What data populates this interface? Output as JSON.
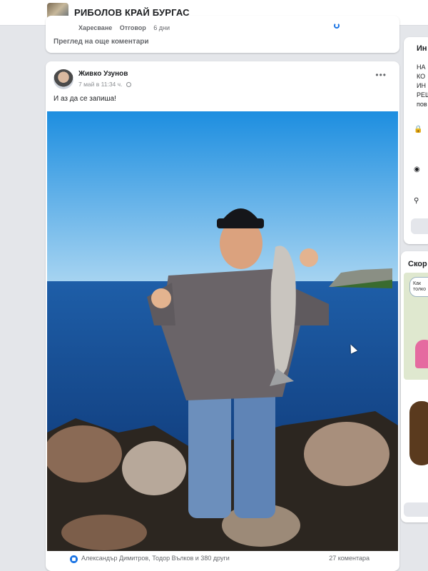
{
  "header": {
    "group_name": "РИБОЛОВ КРАЙ БУРГАС",
    "group_thumb_icon": "group-cover-thumbnail"
  },
  "previous_comments": {
    "like_label": "Харесване",
    "reply_label": "Отговор",
    "time": "6 дни",
    "more_comments_label": "Преглед на още коментари"
  },
  "post": {
    "author": "Живко Узунов",
    "timestamp": "7 май в 11:34 ч.",
    "privacy_icon": "globe-icon",
    "more_icon": "more-options-icon",
    "text": "И аз да се запиша!",
    "photo_icon": "fishing-photo",
    "reactions": {
      "icon": "like-icon",
      "names": "Александър Димитров, Тодор Вълков и 380 други",
      "comments_count": "27 коментара"
    }
  },
  "sidebar": {
    "about_label": "Ин",
    "about_lines": "НА\nКО\nИН\nРЕШ\nпов",
    "shortcuts_label": "Скор",
    "sticker_text": "Как\nтолко"
  },
  "colors": {
    "accent": "#1b74e4",
    "page_bg": "#e4e6ea",
    "card_bg": "#ffffff",
    "text_primary": "#1c1e21",
    "text_secondary": "#65676b"
  }
}
